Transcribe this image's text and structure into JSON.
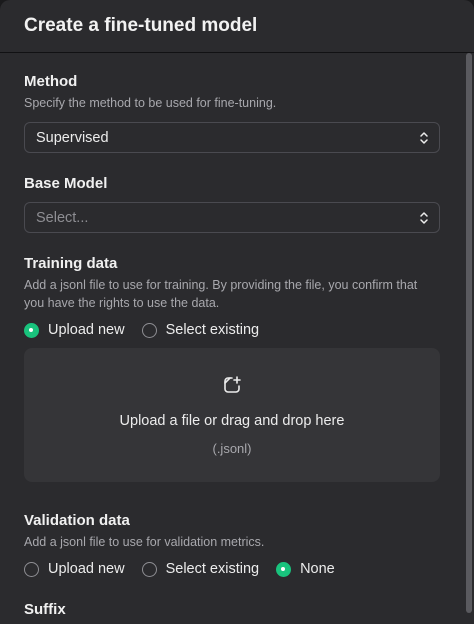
{
  "modal": {
    "title": "Create a fine-tuned model"
  },
  "method": {
    "label": "Method",
    "description": "Specify the method to be used for fine-tuning.",
    "selected": "Supervised"
  },
  "base_model": {
    "label": "Base Model",
    "placeholder": "Select..."
  },
  "training": {
    "label": "Training data",
    "description": "Add a jsonl file to use for training. By providing the file, you confirm that you have the rights to use the data.",
    "options": [
      {
        "label": "Upload new",
        "checked": true
      },
      {
        "label": "Select existing",
        "checked": false
      }
    ],
    "dropzone": {
      "text": "Upload a file or drag and drop here",
      "hint": "(.jsonl)",
      "icon": "file-upload-icon"
    }
  },
  "validation": {
    "label": "Validation data",
    "description": "Add a jsonl file to use for validation metrics.",
    "options": [
      {
        "label": "Upload new",
        "checked": false
      },
      {
        "label": "Select existing",
        "checked": false
      },
      {
        "label": "None",
        "checked": true
      }
    ]
  },
  "suffix": {
    "label": "Suffix"
  },
  "colors": {
    "accent": "#19c37d",
    "panel": "#2b2b2e",
    "dropzone": "#353538"
  }
}
